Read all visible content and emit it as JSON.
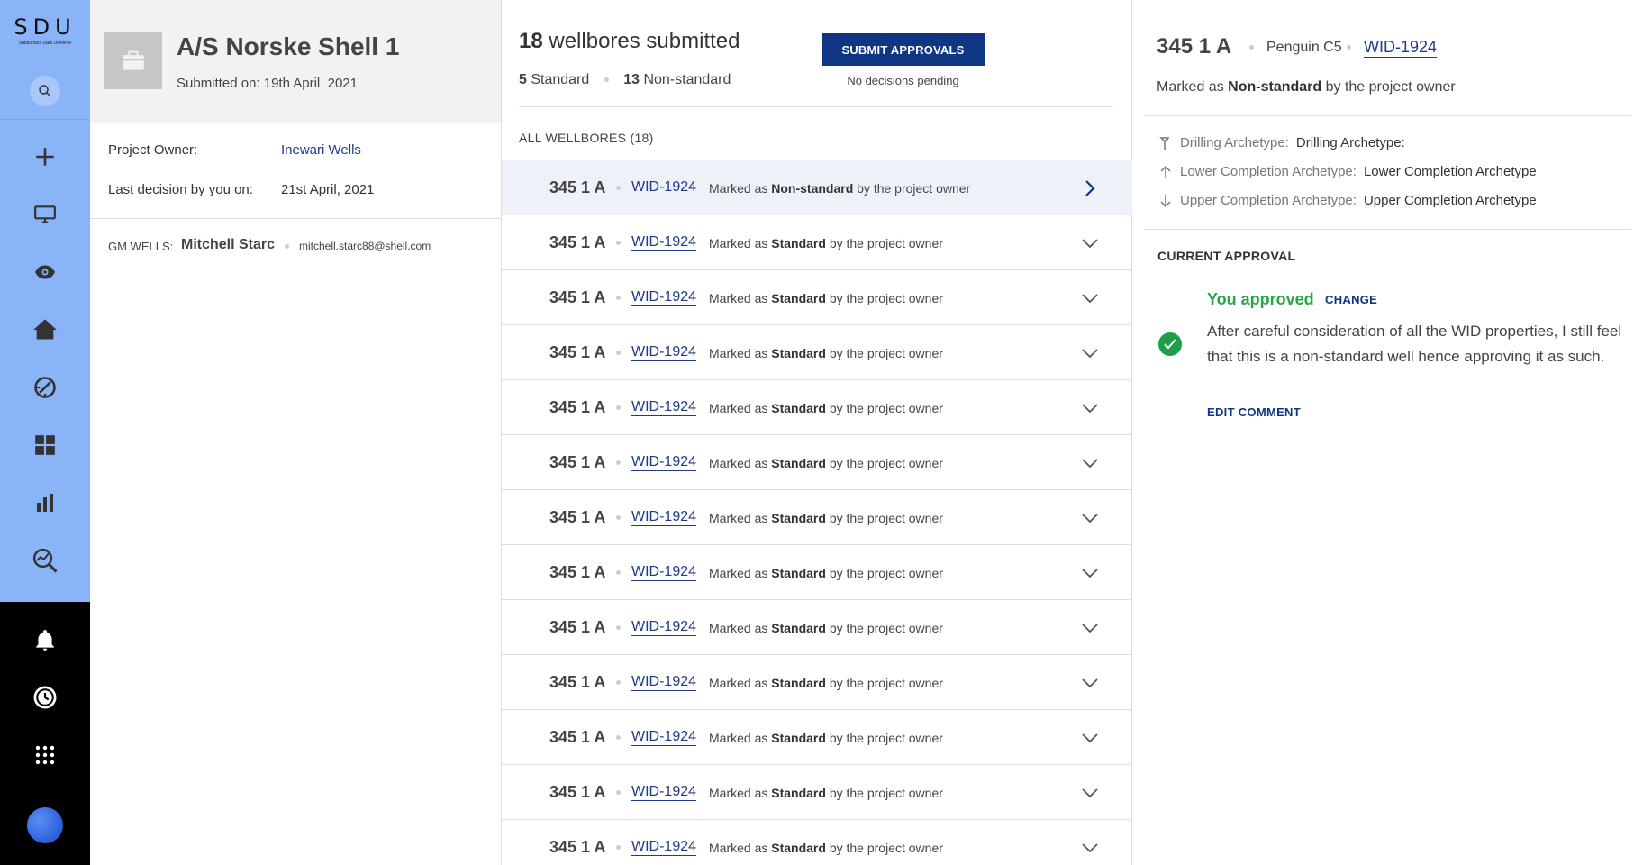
{
  "brand": {
    "name": "SDU",
    "tagline": "Subsurface Data Universe"
  },
  "nav": {
    "icons": [
      "search-icon",
      "plus-icon",
      "monitor-icon",
      "eye-icon",
      "home-icon",
      "gauge-icon",
      "grid-icon",
      "bar-chart-icon",
      "analytics-search-icon",
      "bell-icon",
      "history-icon",
      "apps-icon",
      "avatar"
    ]
  },
  "project": {
    "title": "A/S Norske Shell 1",
    "submitted": "Submitted on: 19th April, 2021",
    "owner_label": "Project Owner:",
    "owner_value": "Inewari Wells",
    "last_decision_label": "Last decision by you on:",
    "last_decision_value": "21st April, 2021",
    "gm_label": "GM WELLS:",
    "gm_name": "Mitchell Starc",
    "gm_email": "mitchell.starc88@shell.com"
  },
  "list": {
    "count": "18",
    "title_rest": "wellbores submitted",
    "standard_count": "5",
    "standard_label": "Standard",
    "nonstandard_count": "13",
    "nonstandard_label": "Non-standard",
    "submit_label": "SUBMIT APPROVALS",
    "pending_text": "No decisions pending",
    "all_label": "ALL WELLBORES (18)",
    "rows": [
      {
        "name": "345 1 A",
        "wid": "WID-1924",
        "prefix": "Marked as",
        "status": "Non-standard",
        "suffix": "by the project owner"
      },
      {
        "name": "345 1 A",
        "wid": "WID-1924",
        "prefix": "Marked as",
        "status": "Standard",
        "suffix": "by the project owner"
      },
      {
        "name": "345 1 A",
        "wid": "WID-1924",
        "prefix": "Marked as",
        "status": "Standard",
        "suffix": "by the project owner"
      },
      {
        "name": "345 1 A",
        "wid": "WID-1924",
        "prefix": "Marked as",
        "status": "Standard",
        "suffix": "by the project owner"
      },
      {
        "name": "345 1 A",
        "wid": "WID-1924",
        "prefix": "Marked as",
        "status": "Standard",
        "suffix": "by the project owner"
      },
      {
        "name": "345 1 A",
        "wid": "WID-1924",
        "prefix": "Marked as",
        "status": "Standard",
        "suffix": "by the project owner"
      },
      {
        "name": "345 1 A",
        "wid": "WID-1924",
        "prefix": "Marked as",
        "status": "Standard",
        "suffix": "by the project owner"
      },
      {
        "name": "345 1 A",
        "wid": "WID-1924",
        "prefix": "Marked as",
        "status": "Standard",
        "suffix": "by the project owner"
      },
      {
        "name": "345 1 A",
        "wid": "WID-1924",
        "prefix": "Marked as",
        "status": "Standard",
        "suffix": "by the project owner"
      },
      {
        "name": "345 1 A",
        "wid": "WID-1924",
        "prefix": "Marked as",
        "status": "Standard",
        "suffix": "by the project owner"
      },
      {
        "name": "345 1 A",
        "wid": "WID-1924",
        "prefix": "Marked as",
        "status": "Standard",
        "suffix": "by the project owner"
      },
      {
        "name": "345 1 A",
        "wid": "WID-1924",
        "prefix": "Marked as",
        "status": "Standard",
        "suffix": "by the project owner"
      },
      {
        "name": "345 1 A",
        "wid": "WID-1924",
        "prefix": "Marked as",
        "status": "Standard",
        "suffix": "by the project owner"
      }
    ]
  },
  "detail": {
    "name": "345 1 A",
    "field": "Penguin C5",
    "wid": "WID-1924",
    "marked_prefix": "Marked as",
    "marked_status": "Non-standard",
    "marked_suffix": "by the project owner",
    "archetypes": [
      {
        "label": "Drilling Archetype:",
        "value": "Drilling Archetype:",
        "icon": "drill-icon"
      },
      {
        "label": "Lower Completion Archetype:",
        "value": "Lower Completion Archetype",
        "icon": "arrow-up-icon"
      },
      {
        "label": "Upper Completion Archetype:",
        "value": "Upper Completion Archetype",
        "icon": "arrow-down-icon"
      }
    ],
    "current_label": "CURRENT APPROVAL",
    "approved_text": "You approved",
    "change_label": "CHANGE",
    "comment": "After careful consideration of all the WID properties, I still feel that this is a non-standard well hence approving it as such.",
    "edit_label": "EDIT COMMENT"
  },
  "colors": {
    "rail": "#8ab4f8",
    "primary": "#0e3683",
    "link": "#1f3a8a",
    "approved": "#28a745",
    "selected_row": "#eef2f8"
  }
}
